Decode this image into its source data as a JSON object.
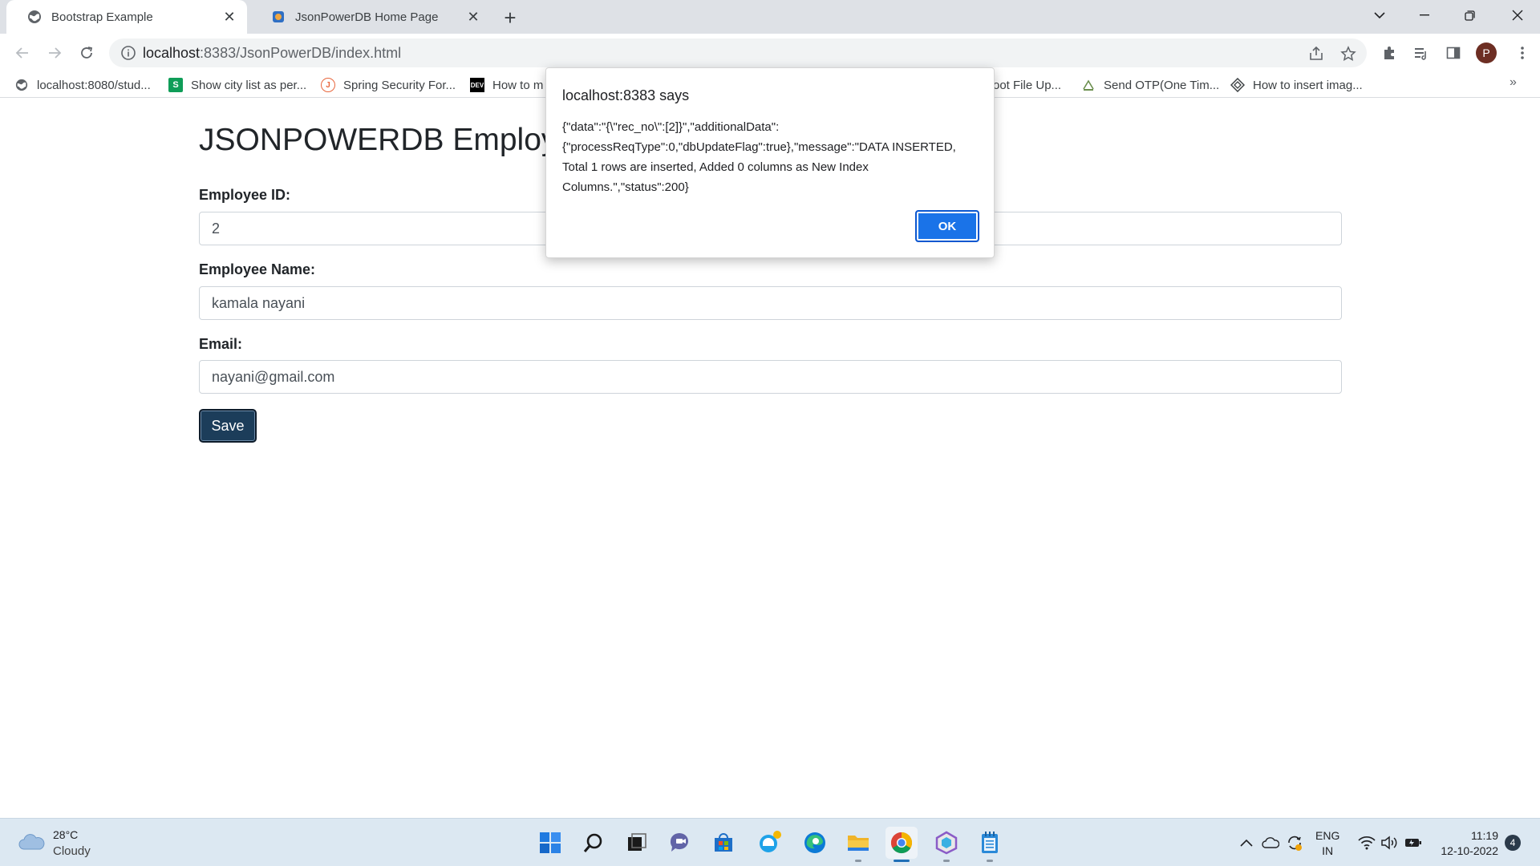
{
  "browser": {
    "tabs": [
      {
        "title": "Bootstrap Example",
        "active": true,
        "icon": "globe-icon"
      },
      {
        "title": "JsonPowerDB Home Page",
        "active": false,
        "icon": "jpdb-icon"
      }
    ],
    "url_host": "localhost",
    "url_path": ":8383/JsonPowerDB/index.html",
    "profile_initial": "P"
  },
  "bookmarks": [
    {
      "label": "localhost:8080/stud...",
      "icon": "globe-icon"
    },
    {
      "label": "Show city list as per...",
      "icon": "s-icon"
    },
    {
      "label": "Spring Security For...",
      "icon": "j-icon"
    },
    {
      "label": "How to m",
      "icon": "dev-icon",
      "icon_text": "DEV"
    },
    {
      "label": "oot File Up...",
      "icon": "none"
    },
    {
      "label": "Send OTP(One Tim...",
      "icon": "otp-icon"
    },
    {
      "label": "How to insert imag...",
      "icon": "diamond-icon"
    }
  ],
  "page": {
    "title": "JSONPOWERDB Employ",
    "fields": [
      {
        "label": "Employee ID:",
        "value": "2"
      },
      {
        "label": "Employee Name:",
        "value": "kamala nayani"
      },
      {
        "label": "Email:",
        "value": "nayani@gmail.com"
      }
    ],
    "save_label": "Save"
  },
  "dialog": {
    "title": "localhost:8383 says",
    "message": "{\"data\":\"{\\\"rec_no\\\":[2]}\",\"additionalData\":{\"processReqType\":0,\"dbUpdateFlag\":true},\"message\":\"DATA INSERTED, Total 1 rows are inserted, Added 0 columns as New Index Columns.\",\"status\":200}",
    "ok_label": "OK"
  },
  "taskbar": {
    "weather_temp": "28°C",
    "weather_condition": "Cloudy",
    "lang_primary": "ENG",
    "lang_secondary": "IN",
    "time": "11:19",
    "date": "12-10-2022",
    "notification_count": "4"
  },
  "colors": {
    "accent": "#1a73e8",
    "save_button": "#1c3d5a",
    "taskbar": "#dce8f2"
  }
}
